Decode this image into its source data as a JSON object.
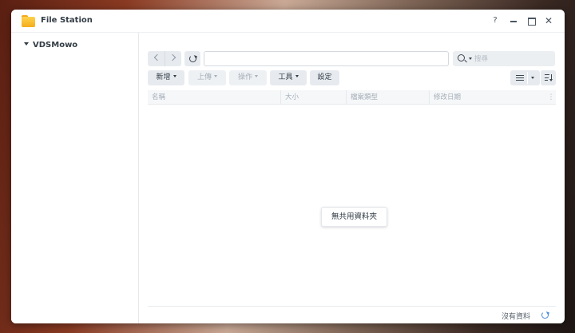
{
  "window": {
    "title": "File Station",
    "help_label": "?",
    "close_label": "✕"
  },
  "sidebar": {
    "root_label": "VDSMowo"
  },
  "toolbar": {
    "path_value": "",
    "search_placeholder": "搜尋",
    "new_label": "新增",
    "upload_label": "上傳",
    "action_label": "操作",
    "tools_label": "工具",
    "settings_label": "設定"
  },
  "grid": {
    "columns": [
      "名稱",
      "大小",
      "檔案類型",
      "修改日期"
    ],
    "menu_glyph": "⋮"
  },
  "empty_message": "無共用資料夾",
  "status": {
    "text": "沒有資料"
  },
  "colors": {
    "accent": "#4a90d9",
    "folder": "#f3ad1c"
  }
}
